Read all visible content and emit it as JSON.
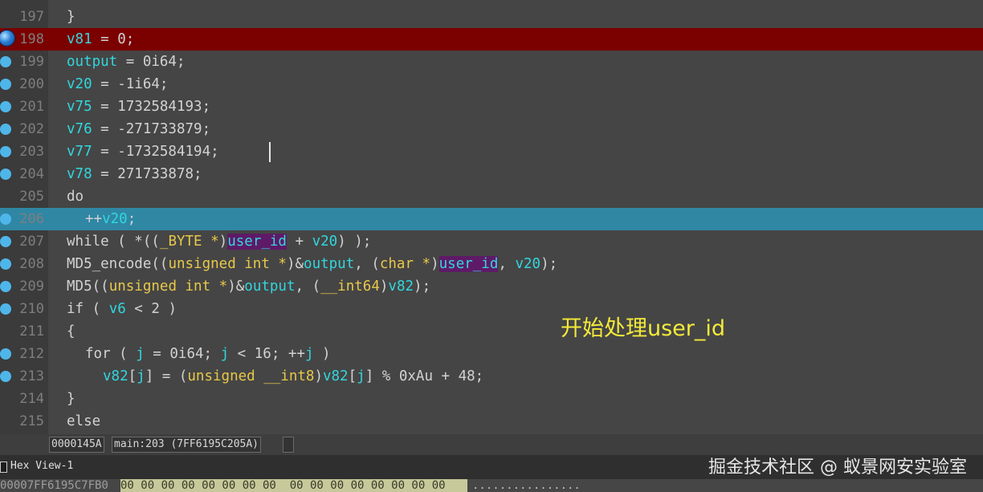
{
  "editor": {
    "lines": [
      {
        "num": "197",
        "text": "}"
      },
      {
        "num": "198",
        "text": "v81 = 0;"
      },
      {
        "num": "199",
        "text": "output = 0i64;"
      },
      {
        "num": "200",
        "text": "v20 = -1i64;"
      },
      {
        "num": "201",
        "text": "v75 = 1732584193;"
      },
      {
        "num": "202",
        "text": "v76 = -271733879;"
      },
      {
        "num": "203",
        "text": "v77 = -1732584194;"
      },
      {
        "num": "204",
        "text": "v78 = 271733878;"
      },
      {
        "num": "205",
        "text": "do"
      },
      {
        "num": "206",
        "text": "++v20;"
      },
      {
        "num": "207",
        "text": "while ( *((_BYTE *)user_id + v20) );"
      },
      {
        "num": "208",
        "text": "MD5_encode((unsigned int *)&output, (char *)user_id, v20);"
      },
      {
        "num": "209",
        "text": "MD5((unsigned int *)&output, (__int64)v82);"
      },
      {
        "num": "210",
        "text": "if ( v6 < 2 )"
      },
      {
        "num": "211",
        "text": "{"
      },
      {
        "num": "212",
        "text": "for ( j = 0i64; j < 16; ++j )"
      },
      {
        "num": "213",
        "text": "v82[j] = (unsigned __int8)v82[j] % 0xAu + 48;"
      },
      {
        "num": "214",
        "text": "}"
      },
      {
        "num": "215",
        "text": "else"
      }
    ]
  },
  "annotation": "开始处理user_id",
  "status": {
    "offset": "0000145A",
    "location": "main:203 (7FF6195C205A)"
  },
  "hex_view": {
    "title": "Hex View-1",
    "address": "00007FF6195C7FB0",
    "bytes": "00 00 00 00 00 00 00 00  00 00 00 00 00 00 00 00",
    "ascii": "................"
  },
  "watermark": "掘金技术社区 @ 蚁景网安实验室",
  "colors": {
    "breakpoint_line": "#7b0000",
    "current_line": "#2f87a4",
    "identifier": "#32d6dd",
    "type_keyword": "#e8c84a",
    "highlight_bg": "#5e1a66",
    "annotation": "#f4ea3a"
  }
}
